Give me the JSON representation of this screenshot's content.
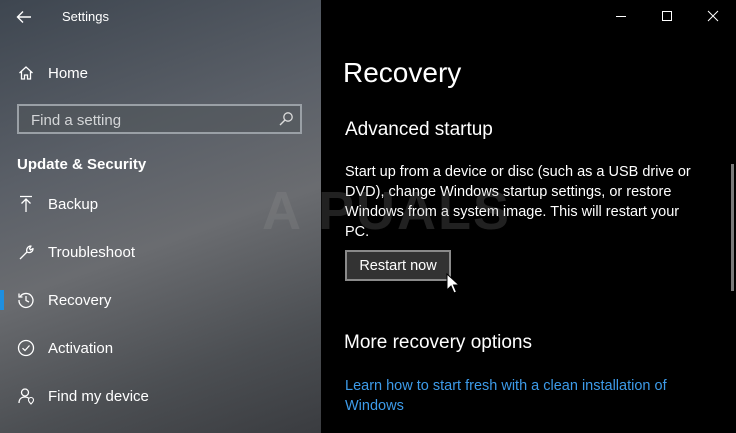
{
  "window": {
    "app_title": "Settings",
    "controls": [
      "minimize",
      "maximize",
      "close"
    ]
  },
  "sidebar": {
    "home_label": "Home",
    "search": {
      "placeholder": "Find a setting"
    },
    "section_heading": "Update & Security",
    "items": [
      {
        "label": "Backup",
        "icon": "backup-arrow-icon",
        "selected": false
      },
      {
        "label": "Troubleshoot",
        "icon": "wrench-icon",
        "selected": false
      },
      {
        "label": "Recovery",
        "icon": "history-icon",
        "selected": true
      },
      {
        "label": "Activation",
        "icon": "check-circle-icon",
        "selected": false
      },
      {
        "label": "Find my device",
        "icon": "person-pin-icon",
        "selected": false
      }
    ]
  },
  "main": {
    "page_title": "Recovery",
    "advanced_startup": {
      "heading": "Advanced startup",
      "description": "Start up from a device or disc (such as a USB drive or DVD), change Windows startup settings, or restore Windows from a system image. This will restart your PC.",
      "button_label": "Restart now"
    },
    "more_options": {
      "heading": "More recovery options",
      "link_text": "Learn how to start fresh with a clean installation of Windows"
    }
  },
  "watermark": "A  PUALS",
  "colors": {
    "accent": "#1e8fe0",
    "link": "#3d9be9",
    "main_background": "#000000"
  }
}
